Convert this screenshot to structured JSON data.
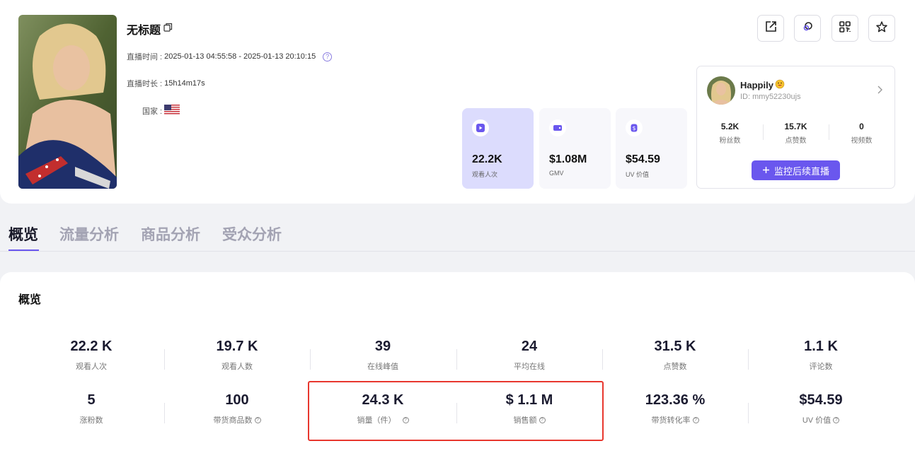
{
  "header": {
    "title": "无标题",
    "broadcast_time_label": "直播时间 :",
    "broadcast_time_value": "2025-01-13 04:55:58 - 2025-01-13 20:10:15",
    "duration_label": "直播时长 :",
    "duration_value": "15h14m17s",
    "country_label": "国家 :"
  },
  "kpis": [
    {
      "value": "22.2K",
      "label": "观看人次"
    },
    {
      "value": "$1.08M",
      "label": "GMV"
    },
    {
      "value": "$54.59",
      "label": "UV 价值"
    }
  ],
  "creator": {
    "name": "Happily",
    "id": "ID: mmy52230ujs",
    "stats": [
      {
        "value": "5.2K",
        "label": "粉丝数"
      },
      {
        "value": "15.7K",
        "label": "点赞数"
      },
      {
        "value": "0",
        "label": "视频数"
      }
    ],
    "monitor_button": "监控后续直播"
  },
  "tabs": [
    "概览",
    "流量分析",
    "商品分析",
    "受众分析"
  ],
  "overview": {
    "title": "概览",
    "row1": [
      {
        "value": "22.2 K",
        "label": "观看人次"
      },
      {
        "value": "19.7 K",
        "label": "观看人数"
      },
      {
        "value": "39",
        "label": "在线峰值"
      },
      {
        "value": "24",
        "label": "平均在线"
      },
      {
        "value": "31.5 K",
        "label": "点赞数"
      },
      {
        "value": "1.1 K",
        "label": "评论数"
      }
    ],
    "row2": [
      {
        "value": "5",
        "label": "涨粉数"
      },
      {
        "value": "100",
        "label": "带货商品数"
      },
      {
        "value": "24.3 K",
        "label": "销量（件）"
      },
      {
        "value": "$ 1.1 M",
        "label": "销售额"
      },
      {
        "value": "123.36 %",
        "label": "带货转化率"
      },
      {
        "value": "$54.59",
        "label": "UV 价值"
      }
    ]
  },
  "colors": {
    "accent": "#6a57ee",
    "highlight": "#e8372e"
  }
}
